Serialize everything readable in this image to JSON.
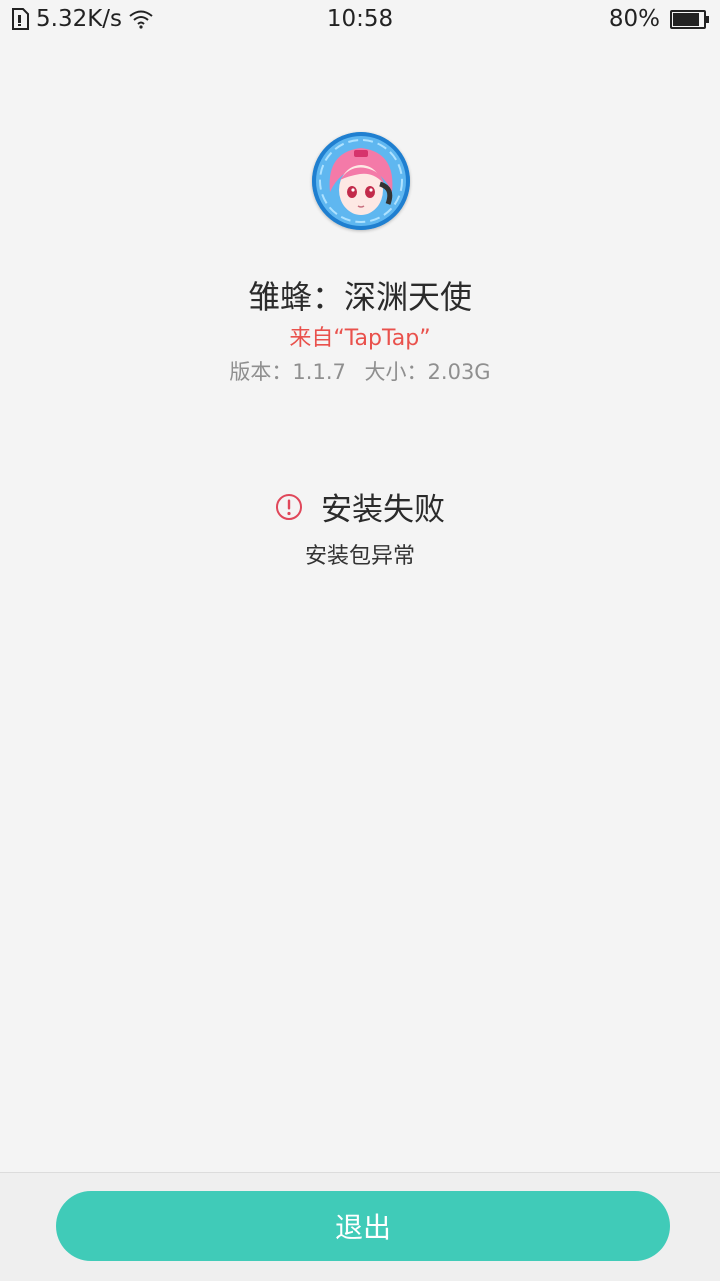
{
  "status_bar": {
    "net_speed": "5.32K/s",
    "time": "10:58",
    "battery_percent": "80%",
    "battery_level": 0.8
  },
  "app": {
    "icon": "anime-character-app-icon",
    "name": "雏蜂：深渊天使",
    "source": "来自“TapTap”",
    "version": "版本：1.1.7",
    "size": "大小：2.03G"
  },
  "result": {
    "icon": "error-exclamation-icon",
    "title": "安装失败",
    "detail": "安装包异常",
    "accent_color": "#e9514c"
  },
  "footer": {
    "exit_label": "退出",
    "button_color": "#40cbb8"
  }
}
